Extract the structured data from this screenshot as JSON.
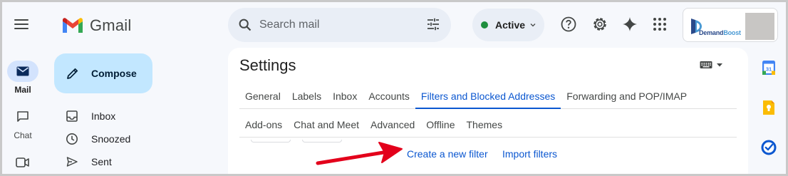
{
  "app": {
    "name": "Gmail"
  },
  "rail": {
    "items": [
      {
        "label": "Mail",
        "icon": "mail-icon",
        "active": true
      },
      {
        "label": "Chat",
        "icon": "chat-icon",
        "active": false
      },
      {
        "label": "",
        "icon": "meet-icon",
        "active": false
      }
    ]
  },
  "compose": {
    "label": "Compose"
  },
  "nav": {
    "items": [
      {
        "label": "Inbox",
        "icon": "inbox-icon"
      },
      {
        "label": "Snoozed",
        "icon": "clock-icon"
      },
      {
        "label": "Sent",
        "icon": "send-icon"
      }
    ]
  },
  "search": {
    "placeholder": "Search mail",
    "value": ""
  },
  "status": {
    "label": "Active",
    "color": "#1e8e3e"
  },
  "account": {
    "brand_prefix": "Demand",
    "brand_suffix": "Boost"
  },
  "settings": {
    "title": "Settings",
    "tabs_row1": [
      {
        "label": "General",
        "active": false
      },
      {
        "label": "Labels",
        "active": false
      },
      {
        "label": "Inbox",
        "active": false
      },
      {
        "label": "Accounts",
        "active": false
      },
      {
        "label": "Filters and Blocked Addresses",
        "active": true
      },
      {
        "label": "Forwarding and POP/IMAP",
        "active": false
      }
    ],
    "tabs_row2": [
      {
        "label": "Add-ons",
        "active": false
      },
      {
        "label": "Chat and Meet",
        "active": false
      },
      {
        "label": "Advanced",
        "active": false
      },
      {
        "label": "Offline",
        "active": false
      },
      {
        "label": "Themes",
        "active": false
      }
    ],
    "links": {
      "create_filter": "Create a new filter",
      "import_filters": "Import filters"
    }
  },
  "side_panel": {
    "icons": [
      "calendar-icon",
      "keep-icon",
      "tasks-icon"
    ],
    "calendar_day": "31"
  },
  "colors": {
    "accent": "#0b57d0",
    "compose_bg": "#c2e7ff",
    "annotation_arrow": "#e3001b"
  }
}
